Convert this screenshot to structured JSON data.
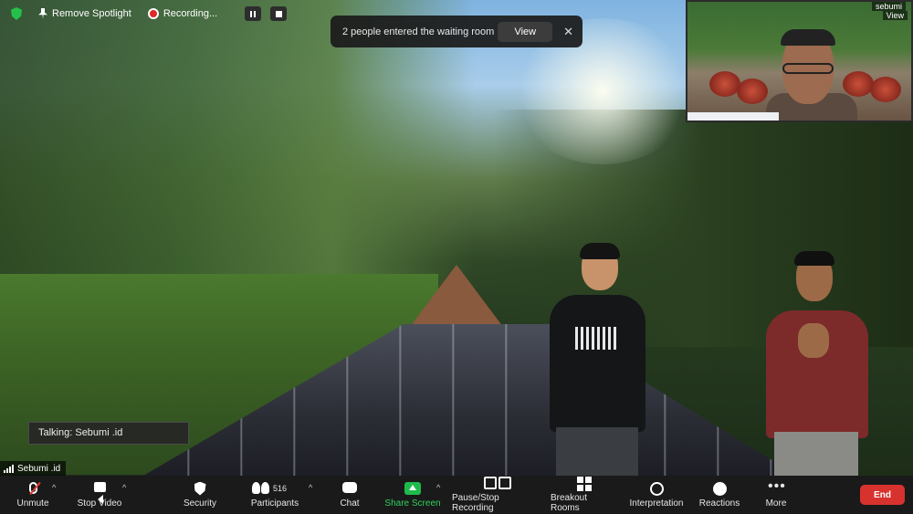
{
  "top_bar": {
    "spotlight_label": "Remove Spotlight",
    "recording_label": "Recording..."
  },
  "notification": {
    "message": "2 people entered the waiting room",
    "view_label": "View",
    "close_glyph": "✕"
  },
  "thumbnail": {
    "name_label": "sebumi",
    "view_label": "View"
  },
  "talking_indicator": "Talking: Sebumi .id",
  "speaker_name": "Sebumi .id",
  "toolbar": {
    "unmute": "Unmute",
    "stop_video": "Stop Video",
    "security": "Security",
    "participants": "Participants",
    "participants_count": "516",
    "chat": "Chat",
    "share_screen": "Share Screen",
    "pause_stop_recording": "Pause/Stop Recording",
    "breakout_rooms": "Breakout Rooms",
    "interpretation": "Interpretation",
    "reactions": "Reactions",
    "more": "More",
    "end": "End",
    "more_glyph": "•••",
    "caret_glyph": "^"
  },
  "colors": {
    "share_green": "#2ed15c",
    "end_red": "#d8322e",
    "secure_green": "#24c24a",
    "recording_red": "#e02828"
  }
}
